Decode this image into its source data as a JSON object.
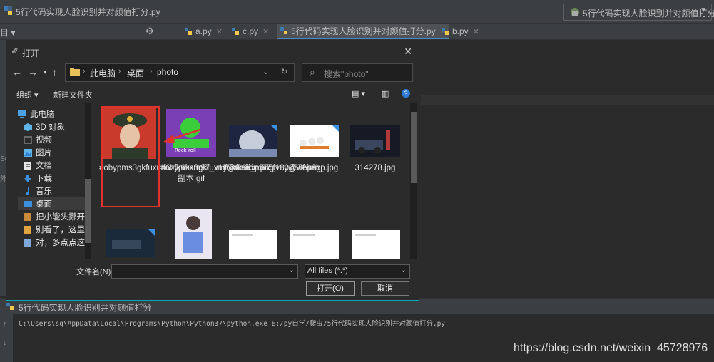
{
  "ide": {
    "window_title": "5行代码实现人脸识别并对颜值打分.py",
    "run_config_label": "5行代码实现人脸识别并对颜值打分",
    "tabs": [
      {
        "label": "a.py"
      },
      {
        "label": "c.py"
      },
      {
        "label": "5行代码实现人脸识别并对颜值打分.py",
        "active": true
      },
      {
        "label": "b.py"
      }
    ],
    "run_panel_title": "5行代码实现人脸识别并对颜值打分",
    "run_command": "C:\\Users\\sq\\AppData\\Local\\Programs\\Python\\Python37\\python.exe E:/py自学/爬虫/5行代码实现人脸识别并对颜值打分.py",
    "left_fragments": [
      "Se",
      "外"
    ]
  },
  "dialog": {
    "title": "打开",
    "breadcrumbs": [
      "此电脑",
      "桌面",
      "photo"
    ],
    "search_placeholder": "搜索\"photo\"",
    "organize_label": "组织 ▾",
    "new_folder_label": "新建文件夹",
    "tree": [
      {
        "label": "此电脑",
        "icon": "computer-icon"
      },
      {
        "label": "3D 对象",
        "icon": "3d-objects-icon"
      },
      {
        "label": "视频",
        "icon": "video-icon"
      },
      {
        "label": "图片",
        "icon": "pictures-icon"
      },
      {
        "label": "文档",
        "icon": "documents-icon"
      },
      {
        "label": "下载",
        "icon": "download-icon"
      },
      {
        "label": "音乐",
        "icon": "music-icon"
      },
      {
        "label": "桌面",
        "icon": "desktop-icon",
        "selected": true
      },
      {
        "label": "把小能头挪开",
        "icon": "file-icon"
      },
      {
        "label": "别看了，这里",
        "icon": "file-icon"
      },
      {
        "label": "对，多点点这",
        "icon": "file-icon"
      }
    ],
    "files": [
      {
        "name": "#obypms3gkfuxmf6zfk6kxm97_v1y@weixin.png"
      },
      {
        "name": "#obypms3gkfuxmf6zfk6kxm97_v1y@weixin_副本.gif"
      },
      {
        "name": "16sucai_p585f180_37f.png"
      },
      {
        "name": "260.webp.jpg"
      },
      {
        "name": "314278.jpg"
      }
    ],
    "filename_label": "文件名(N):",
    "filename_value": "",
    "filter_label": "All files (*.*)",
    "open_label": "打开(O)",
    "cancel_label": "取消"
  },
  "watermark": "https://blog.csdn.net/weixin_45728976",
  "colors": {
    "accent": "#00a8b5",
    "highlight": "#e0332c",
    "tab_underline": "#4a88c7"
  }
}
